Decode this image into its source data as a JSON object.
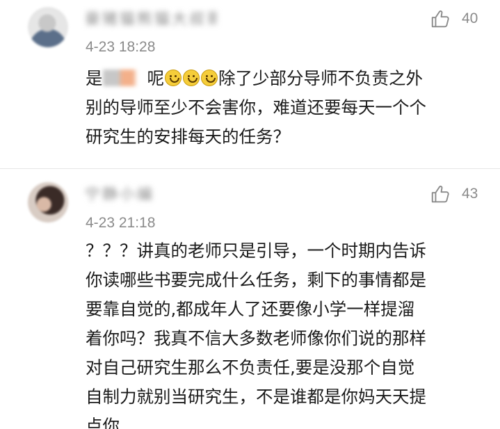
{
  "comments": [
    {
      "username": "豪猪猫熊猫大叔哥",
      "time": "4-23 18:28",
      "likes": "40",
      "lines": [
        {
          "before": "是",
          "after": "呢",
          "rest": "除了少部分导师不负责之外"
        },
        "别的导师至少不会害你，难道还要每天一个个",
        "研究生的安排每天的任务？"
      ]
    },
    {
      "username": "宁静小编",
      "time": "4-23 21:18",
      "likes": "43",
      "lines": [
        "？？？讲真的老师只是引导，一个时期内告诉",
        "你读哪些书要完成什么任务，剩下的事情都是",
        "要靠自觉的,都成年人了还要像小学一样提溜",
        "着你吗？我真不信大多数老师像你们说的那样",
        "对自己研究生那么不负责任,要是没那个自觉",
        "自制力就别当研究生，不是谁都是你妈天天提",
        "点你"
      ]
    }
  ],
  "icons": {
    "like": "thumbs-up-icon",
    "emoji": "smiley-emoji-icon"
  },
  "colors": {
    "meta_text": "#8a8a8a",
    "body_text": "#1a1a1a",
    "divider": "#e6e6e6"
  }
}
